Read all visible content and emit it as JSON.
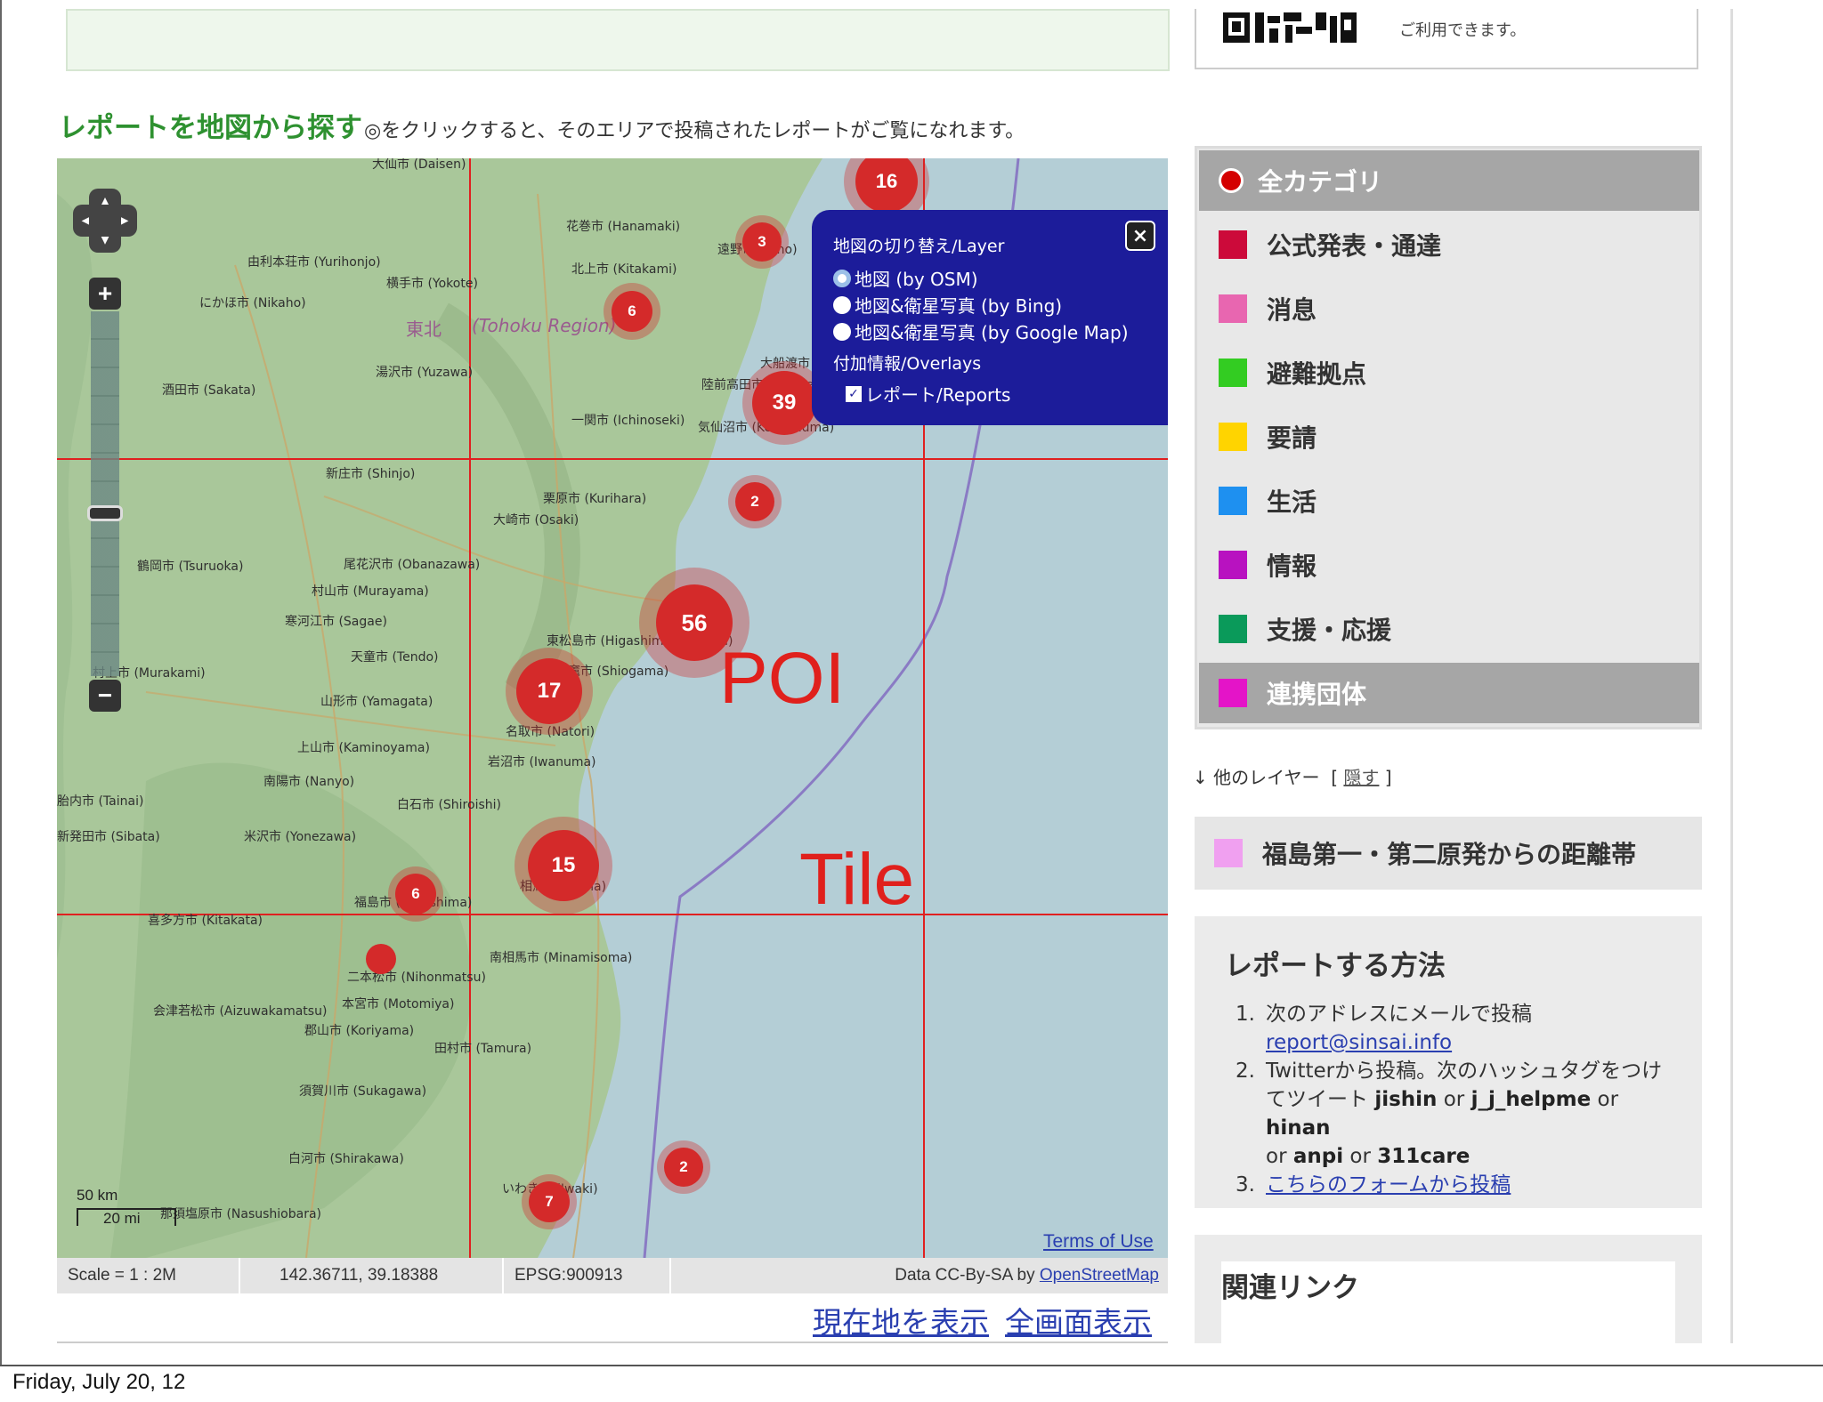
{
  "header": {
    "qr_note": "ご利用できます。",
    "section_title": "レポートを地図から探す",
    "section_desc": "◎をクリックすると、そのエリアで投稿されたレポートがご覧になれます。"
  },
  "map": {
    "region_jp": "東北",
    "region_en": "(Tohoku Region)",
    "places": [
      "大仙市 (Daisen)",
      "花巻市 (Hanamaki)",
      "由利本荘市 (Yurihonjo)",
      "横手市 (Yokote)",
      "北上市 (Kitakami)",
      "にかほ市 (Nikaho)",
      "遠野市 (Tono)",
      "湯沢市 (Yuzawa)",
      "大船渡市",
      "酒田市 (Sakata)",
      "陸前高田市 (Rikuzen Takata)",
      "一関市 (Ichinoseki)",
      "気仙沼市 (Kesennuma)",
      "新庄市 (Shinjo)",
      "栗原市 (Kurihara)",
      "大崎市 (Osaki)",
      "鶴岡市 (Tsuruoka)",
      "尾花沢市 (Obanazawa)",
      "村山市 (Murayama)",
      "寒河江市 (Sagae)",
      "東松島市 (Higashimatsushima)",
      "天童市 (Tendo)",
      "塩竈市 (Shiogama)",
      "村上市 (Murakami)",
      "山形市 (Yamagata)",
      "名取市 (Natori)",
      "上山市 (Kaminoyama)",
      "岩沼市 (Iwanuma)",
      "南陽市 (Nanyo)",
      "胎内市 (Tainai)",
      "白石市 (Shiroishi)",
      "新発田市 (Sibata)",
      "米沢市 (Yonezawa)",
      "相馬市 (Soma)",
      "福島市 (Fukushima)",
      "喜多方市 (Kitakata)",
      "南相馬市 (Minamisoma)",
      "二本松市 (Nihonmatsu)",
      "会津若松市 (Aizuwakamatsu)",
      "本宮市 (Motomiya)",
      "郡山市 (Koriyama)",
      "田村市 (Tamura)",
      "須賀川市 (Sukagawa)",
      "白河市 (Shirakawa)",
      "いわき市 (Iwaki)",
      "那須塩原市 (Nasushiobara)"
    ],
    "clusters": [
      {
        "label": "16",
        "count": 16
      },
      {
        "label": "3",
        "count": 3
      },
      {
        "label": "6",
        "count": 6
      },
      {
        "label": "39",
        "count": 39
      },
      {
        "label": "2",
        "count": 2
      },
      {
        "label": "56",
        "count": 56
      },
      {
        "label": "17",
        "count": 17
      },
      {
        "label": "15",
        "count": 15
      },
      {
        "label": "6",
        "count": 6
      },
      {
        "label": "",
        "count": 1
      },
      {
        "label": "2",
        "count": 2
      },
      {
        "label": "7",
        "count": 7
      }
    ],
    "annotation_poi": "POI",
    "annotation_tile": "Tile",
    "scale_km": "50 km",
    "scale_mi": "20 mi",
    "terms": "Terms of Use",
    "layer_switcher": {
      "base_title": "地図の切り替え/Layer",
      "base_options": [
        "地図 (by OSM)",
        "地図&衛星写真 (by Bing)",
        "地図&衛星写真 (by Google Map)"
      ],
      "selected_base": "地図 (by OSM)",
      "overlay_title": "付加情報/Overlays",
      "overlays": [
        "レポート/Reports"
      ],
      "close_icon": "×"
    },
    "status": {
      "scale": "Scale = 1 : 2M",
      "coords": "142.36711, 39.18388",
      "projection": "EPSG:900913",
      "attribution_prefix": "Data CC-By-SA by ",
      "attribution_link": "OpenStreetMap"
    },
    "links": {
      "current_location": "現在地を表示",
      "fullscreen": "全画面表示"
    }
  },
  "categories": {
    "items": [
      {
        "label": "全カテゴリ",
        "color": "#d40000",
        "highlight": true
      },
      {
        "label": "公式発表・通達",
        "color": "#cc0a3a"
      },
      {
        "label": "消息",
        "color": "#e866b0"
      },
      {
        "label": "避難拠点",
        "color": "#33cc22"
      },
      {
        "label": "要請",
        "color": "#ffd400"
      },
      {
        "label": "生活",
        "color": "#1e90f0"
      },
      {
        "label": "情報",
        "color": "#b812c0"
      },
      {
        "label": "支援・応援",
        "color": "#0a9a5a"
      },
      {
        "label": "連携団体",
        "color": "#e414c8",
        "highlight": true
      }
    ]
  },
  "other_layers": {
    "arrow": "↓",
    "label": "他のレイヤー",
    "toggle": "隠す",
    "bracket_open": "[",
    "bracket_close": "]",
    "items": [
      {
        "label": "福島第一・第二原発からの距離帯",
        "color": "#f0a0f0"
      }
    ]
  },
  "howto": {
    "title": "レポートする方法",
    "step1_num": "1.",
    "step1_text": "次のアドレスにメールで投稿",
    "step1_link": "report@sinsai.info",
    "step2_num": "2.",
    "step2_text_a": "Twitterから投稿。次のハッシュタグをつけてツイート ",
    "tag1": "jishin",
    "or": " or ",
    "tag2": "j_j_helpme",
    "tag3": "hinan",
    "tag4": "anpi",
    "tag5": "311care",
    "step3_num": "3.",
    "step3_link": "こちらのフォームから投稿"
  },
  "related": {
    "title": "関連リンク"
  },
  "footer": {
    "date": "Friday, July 20, 12"
  },
  "colors": {
    "grid_line": "#e02020",
    "panel_blue": "#1c1c9a",
    "cluster_red": "#d42a2a",
    "land": "#a9c79a",
    "sea": "#b4ced6"
  }
}
